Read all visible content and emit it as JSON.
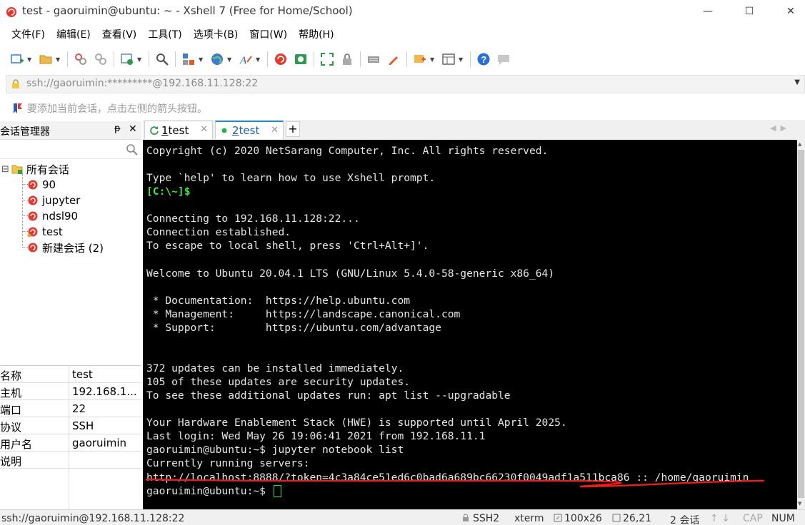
{
  "window": {
    "title": "test - gaoruimin@ubuntu: ~ - Xshell 7 (Free for Home/School)",
    "minimize": "—",
    "maximize": "☐",
    "close": "✕"
  },
  "menu": [
    "文件(F)",
    "编辑(E)",
    "查看(V)",
    "工具(T)",
    "选项卡(B)",
    "窗口(W)",
    "帮助(H)"
  ],
  "address": {
    "value": "ssh://gaoruimin:*********@192.168.11.128:22"
  },
  "hint": {
    "text": "要添加当前会话，点击左侧的箭头按钮。"
  },
  "session_manager": {
    "title": "会话管理器",
    "pin": "ᵽ",
    "close": "✕",
    "root": "所有会话",
    "expander": "⊟",
    "sessions": [
      "90",
      "jupyter",
      "ndsl90",
      "test",
      "新建会话 (2)"
    ]
  },
  "properties": [
    {
      "key": "名称",
      "value": "test"
    },
    {
      "key": "主机",
      "value": "192.168.1..."
    },
    {
      "key": "端口",
      "value": "22"
    },
    {
      "key": "协议",
      "value": "SSH"
    },
    {
      "key": "用户名",
      "value": "gaoruimin"
    },
    {
      "key": "说明",
      "value": ""
    }
  ],
  "tabs": [
    {
      "number": "1",
      "label": " test",
      "close": "✕"
    },
    {
      "number": "2",
      "label": " test",
      "close": "✕"
    }
  ],
  "tab_add": "+",
  "tab_scroll": "◀▶",
  "terminal": {
    "lines": [
      {
        "text": "Copyright (c) 2020 NetSarang Computer, Inc. All rights reserved.",
        "style": "normal"
      },
      {
        "text": "",
        "style": "normal"
      },
      {
        "text": "Type `help' to learn how to use Xshell prompt.",
        "style": "normal"
      },
      {
        "text": "[C:\\~]$",
        "style": "green"
      },
      {
        "text": "",
        "style": "normal"
      },
      {
        "text": "Connecting to 192.168.11.128:22...",
        "style": "normal"
      },
      {
        "text": "Connection established.",
        "style": "normal"
      },
      {
        "text": "To escape to local shell, press 'Ctrl+Alt+]'.",
        "style": "normal"
      },
      {
        "text": "",
        "style": "normal"
      },
      {
        "text": "Welcome to Ubuntu 20.04.1 LTS (GNU/Linux 5.4.0-58-generic x86_64)",
        "style": "normal"
      },
      {
        "text": "",
        "style": "normal"
      },
      {
        "text": " * Documentation:  https://help.ubuntu.com",
        "style": "normal"
      },
      {
        "text": " * Management:     https://landscape.canonical.com",
        "style": "normal"
      },
      {
        "text": " * Support:        https://ubuntu.com/advantage",
        "style": "normal"
      },
      {
        "text": "",
        "style": "normal"
      },
      {
        "text": "",
        "style": "normal"
      },
      {
        "text": "372 updates can be installed immediately.",
        "style": "normal"
      },
      {
        "text": "105 of these updates are security updates.",
        "style": "normal"
      },
      {
        "text": "To see these additional updates run: apt list --upgradable",
        "style": "normal"
      },
      {
        "text": "",
        "style": "normal"
      },
      {
        "text": "Your Hardware Enablement Stack (HWE) is supported until April 2025.",
        "style": "normal"
      },
      {
        "text": "Last login: Wed May 26 19:06:41 2021 from 192.168.11.1",
        "style": "normal"
      },
      {
        "text": "gaoruimin@ubuntu:~$ jupyter notebook list",
        "style": "normal"
      },
      {
        "text": "Currently running servers:",
        "style": "normal"
      },
      {
        "text": "http://localhost:8888/?token=4c3a84ce51ed6c0bad6a689bc66230f0049adf1a511bca86 :: /home/gaoruimin",
        "style": "normal"
      },
      {
        "text": "gaoruimin@ubuntu:~$ ",
        "style": "normal",
        "cursor": true
      }
    ]
  },
  "status": {
    "connection": "ssh://gaoruimin@192.168.11.128:22",
    "protocol": "SSH2",
    "term": "xterm",
    "size": "100x26",
    "cursor_pos": "26,21",
    "arrows": "↑ ↓",
    "sessions": "2 会话",
    "cap": "CAP",
    "num": "NUM"
  },
  "colors": {
    "accent": "#1e88e5",
    "terminal_bg": "#000000",
    "prompt_green": "#3ee63e",
    "annotation_red": "#e81e1e"
  }
}
